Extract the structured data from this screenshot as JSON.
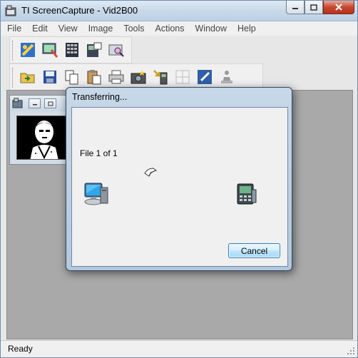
{
  "window": {
    "title": "TI ScreenCapture - Vid2B00",
    "icon": "app-icon",
    "controls": [
      "minimize-icon",
      "maximize-icon",
      "close-icon"
    ]
  },
  "menu": [
    "File",
    "Edit",
    "View",
    "Image",
    "Tools",
    "Actions",
    "Window",
    "Help"
  ],
  "toolbar1": [
    "capture-icon",
    "capture-screen-icon",
    "capture-multiple-icon",
    "calculator-info-icon",
    "explorer-icon"
  ],
  "toolbar2": [
    "open-icon",
    "save-icon",
    "copy-icon",
    "paste-icon",
    "print-icon",
    "camera-icon",
    "send-to-device-icon",
    "grid-icon",
    "edit-icon",
    "animate-icon"
  ],
  "dialog": {
    "title": "Transferring...",
    "status": "File 1 of 1",
    "cancel_label": "Cancel",
    "icons": [
      "computer-icon",
      "paper-fly-icon",
      "calculator-icon"
    ]
  },
  "statusbar": {
    "text": "Ready"
  }
}
